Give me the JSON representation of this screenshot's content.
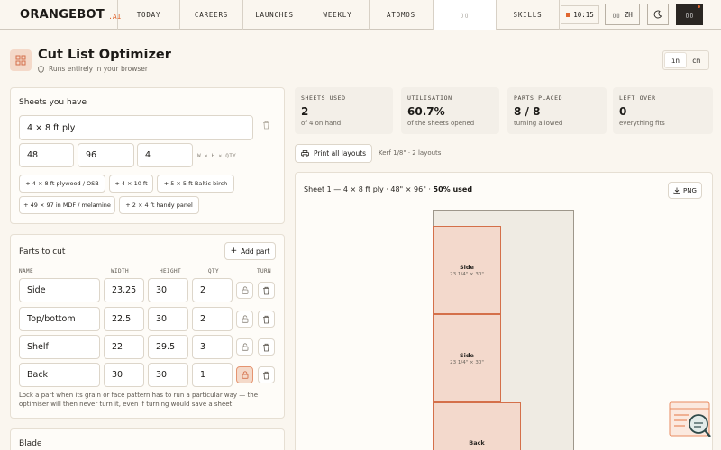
{
  "nav": {
    "logo": "ORANGEBOT",
    "logo_suffix": ".AI",
    "items": [
      "TODAY",
      "CAREERS",
      "LAUNCHES",
      "WEEKLY",
      "ATOMOS",
      "▯▯",
      "SKILLS"
    ],
    "clock": "10:15",
    "lang": "▯▯ ZH",
    "menu": "▯▯"
  },
  "header": {
    "title": "Cut List Optimizer",
    "subtitle": "Runs entirely in your browser",
    "units": [
      "in",
      "cm"
    ],
    "unit_selected": "in"
  },
  "sheets": {
    "title": "Sheets you have",
    "name_value": "4 × 8 ft ply",
    "width": "48",
    "height": "96",
    "qty": "4",
    "dims_hint": "W × H × QTY",
    "presets": [
      "+ 4 × 8 ft plywood / OSB",
      "+ 4 × 10 ft",
      "+ 5 × 5 ft Baltic birch",
      "+ 49 × 97 in MDF / melamine",
      "+ 2 × 4 ft handy panel"
    ]
  },
  "parts": {
    "title": "Parts to cut",
    "add_label": "Add part",
    "columns": [
      "NAME",
      "WIDTH",
      "HEIGHT",
      "QTY",
      "TURN"
    ],
    "rows": [
      {
        "name": "Side",
        "width": "23.25",
        "height": "30",
        "qty": "2",
        "locked": false
      },
      {
        "name": "Top/bottom",
        "width": "22.5",
        "height": "30",
        "qty": "2",
        "locked": false
      },
      {
        "name": "Shelf",
        "width": "22",
        "height": "29.5",
        "qty": "3",
        "locked": false
      },
      {
        "name": "Back",
        "width": "30",
        "height": "30",
        "qty": "1",
        "locked": true
      }
    ],
    "note": "Lock a part when its grain or face pattern has to run a particular way — the optimiser will then never turn it, even if turning would save a sheet."
  },
  "blade": {
    "title": "Blade"
  },
  "stats": [
    {
      "label": "SHEETS USED",
      "value": "2",
      "detail": "of 4 on hand"
    },
    {
      "label": "UTILISATION",
      "value": "60.7%",
      "detail": "of the sheets opened"
    },
    {
      "label": "PARTS PLACED",
      "value": "8 / 8",
      "detail": "turning allowed"
    },
    {
      "label": "LEFT OVER",
      "value": "0",
      "detail": "everything fits"
    }
  ],
  "actions": {
    "print_label": "Print all layouts",
    "kerf_info": "Kerf 1/8\" · 2 layouts"
  },
  "layout": {
    "title_prefix": "Sheet 1 — 4 × 8 ft ply · 48\" × 96\" ·",
    "title_used": "50% used",
    "png_label": "PNG",
    "parts": [
      {
        "name": "Side",
        "dims": "23 1/4\" × 30\""
      },
      {
        "name": "Side",
        "dims": "23 1/4\" × 30\""
      },
      {
        "name": "Back",
        "dims": ""
      }
    ]
  },
  "colors": {
    "accent": "#e0662f",
    "background": "#faf6ef",
    "part_fill": "#f3d9cc",
    "part_stroke": "#d4704a"
  }
}
